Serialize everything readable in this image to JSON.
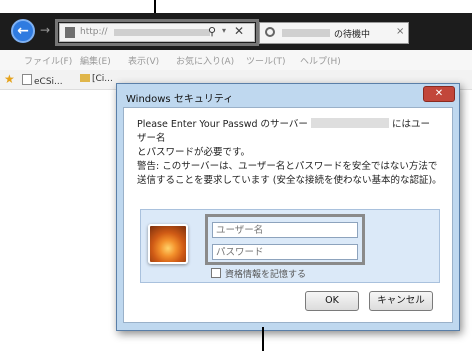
{
  "browser": {
    "address": {
      "prefix": "http://"
    },
    "tab": {
      "label": "の待機中"
    },
    "menu": [
      "ファイル(F)",
      "編集(E)",
      "表示(V)",
      "お気に入り(A)",
      "ツール(T)",
      "ヘルプ(H)"
    ],
    "favorites": [
      "eCSi...",
      "[Ci..."
    ]
  },
  "dialog": {
    "title": "Windows セキュリティ",
    "message_part1": "Please Enter Your Passwd のサーバー",
    "message_part2": "にはユーザー名",
    "message_line2": "とパスワードが必要です。",
    "warning": "警告: このサーバーは、ユーザー名とパスワードを安全ではない方法で送信することを要求しています (安全な接続を使わない基本的な認証)。",
    "username_placeholder": "ユーザー名",
    "password_placeholder": "パスワード",
    "remember_label": "資格情報を記憶する",
    "ok_label": "OK",
    "cancel_label": "キャンセル"
  },
  "colors": {
    "accent": "#2f7be0",
    "close": "#c2463a",
    "frame": "#bfd8ef"
  }
}
